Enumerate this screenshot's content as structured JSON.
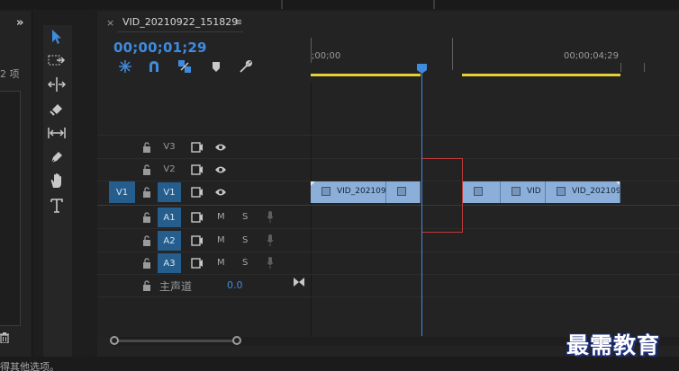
{
  "project_panel": {
    "item_count": "2 项",
    "expand_icon": "double-chevron-right"
  },
  "tools": [
    {
      "name": "selection-tool-icon",
      "active": true
    },
    {
      "name": "track-select-forward-icon"
    },
    {
      "name": "ripple-edit-icon"
    },
    {
      "name": "razor-icon"
    },
    {
      "name": "slip-icon"
    },
    {
      "name": "pen-icon"
    },
    {
      "name": "hand-icon"
    },
    {
      "name": "type-icon"
    }
  ],
  "sequence": {
    "close": "×",
    "title": "VID_20210922_151829",
    "menu": "≡",
    "timecode": "00;00;01;29"
  },
  "ruler": {
    "start_label": ";00;00",
    "end_label": "00;00;04;29"
  },
  "video_tracks": [
    {
      "id": "V3",
      "active": false
    },
    {
      "id": "V2",
      "active": false
    },
    {
      "id": "V1",
      "active": true,
      "source_patch": "V1"
    }
  ],
  "audio_tracks": [
    {
      "id": "A1",
      "mute": "M",
      "solo": "S"
    },
    {
      "id": "A2",
      "mute": "M",
      "solo": "S"
    },
    {
      "id": "A3",
      "mute": "M",
      "solo": "S"
    }
  ],
  "master": {
    "label": "主声道",
    "value": "0.0"
  },
  "clips": [
    {
      "name": "VID_202109"
    },
    {
      "name": ""
    },
    {
      "name": ""
    },
    {
      "name": "VID"
    },
    {
      "name": "VID_202109"
    }
  ],
  "colors": {
    "accent_blue": "#3f8bde",
    "clip_blue": "#8bafd8",
    "work_area_yellow": "#e3d234",
    "gap_highlight_red": "#c03a3a",
    "track_active": "#255d8c"
  },
  "status_text": "得其他选项。",
  "watermark": "最需教育"
}
